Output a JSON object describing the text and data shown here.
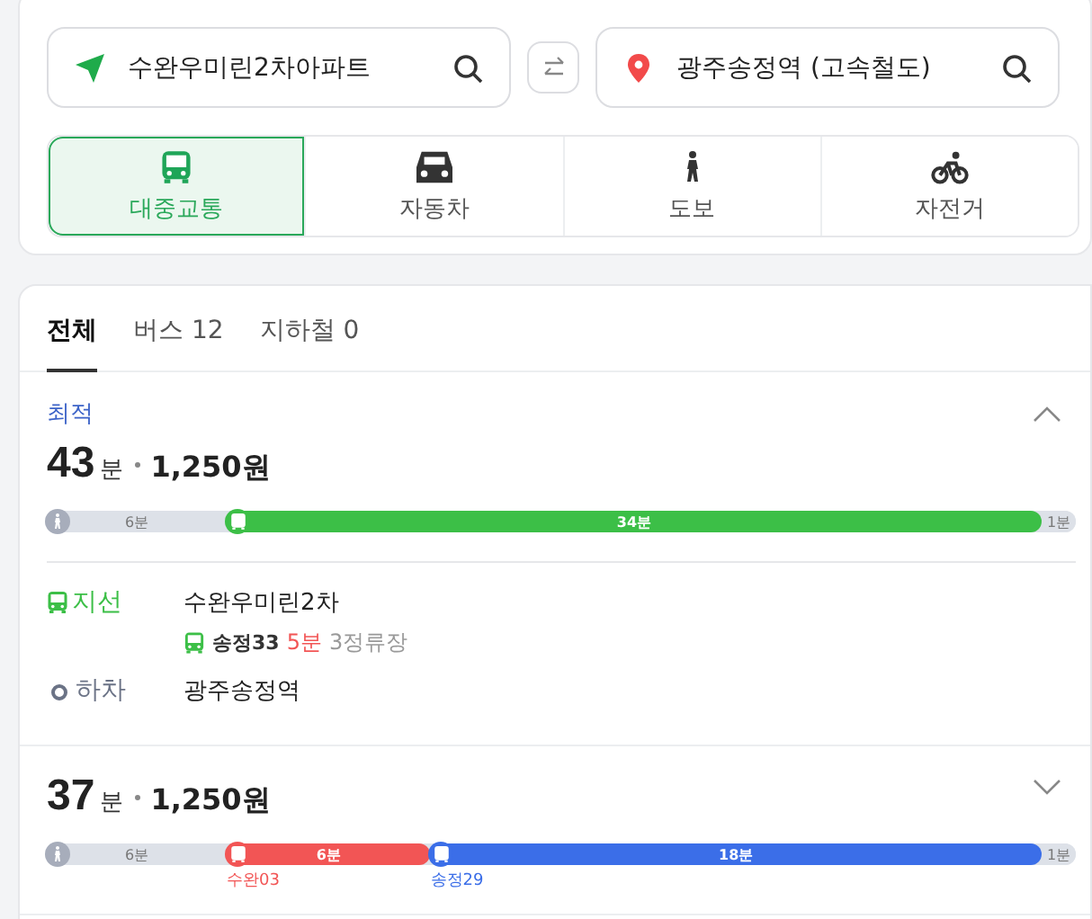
{
  "search": {
    "origin": "수완우미린2차아파트",
    "destination": "광주송정역 (고속철도)"
  },
  "modes": [
    {
      "label": "대중교통",
      "kind": "bus",
      "selected": true
    },
    {
      "label": "자동차",
      "kind": "car",
      "selected": false
    },
    {
      "label": "도보",
      "kind": "walk",
      "selected": false
    },
    {
      "label": "자전거",
      "kind": "bike",
      "selected": false
    }
  ],
  "tabs": [
    {
      "label": "전체",
      "selected": true
    },
    {
      "label": "버스 12",
      "selected": false
    },
    {
      "label": "지하철 0",
      "selected": false
    }
  ],
  "routes": [
    {
      "badge": "최적",
      "time": "43",
      "unit": "분",
      "fare": "1,250원",
      "expanded": true,
      "segments": [
        {
          "kind": "walk",
          "label": "6분",
          "color": "#dde1e8"
        },
        {
          "kind": "bus",
          "label": "34분",
          "color": "#3cbf47"
        },
        {
          "kind": "end",
          "label": "1분",
          "color": "#dde1e8"
        }
      ],
      "steps": [
        {
          "kind": "board",
          "type": "지선",
          "stop": "수완우미린2차",
          "line": "송정33",
          "wait": "5분",
          "stops": "3정류장"
        },
        {
          "kind": "alight",
          "type": "하차",
          "stop": "광주송정역"
        }
      ]
    },
    {
      "time": "37",
      "unit": "분",
      "fare": "1,250원",
      "expanded": false,
      "segments": [
        {
          "kind": "walk",
          "label": "6분",
          "color": "#dde1e8"
        },
        {
          "kind": "bus",
          "label": "6분",
          "color": "#f25555",
          "line": "수완03"
        },
        {
          "kind": "bus",
          "label": "18분",
          "color": "#3b6ee8",
          "line": "송정29"
        },
        {
          "kind": "end",
          "label": "1분",
          "color": "#dde1e8"
        }
      ]
    }
  ]
}
